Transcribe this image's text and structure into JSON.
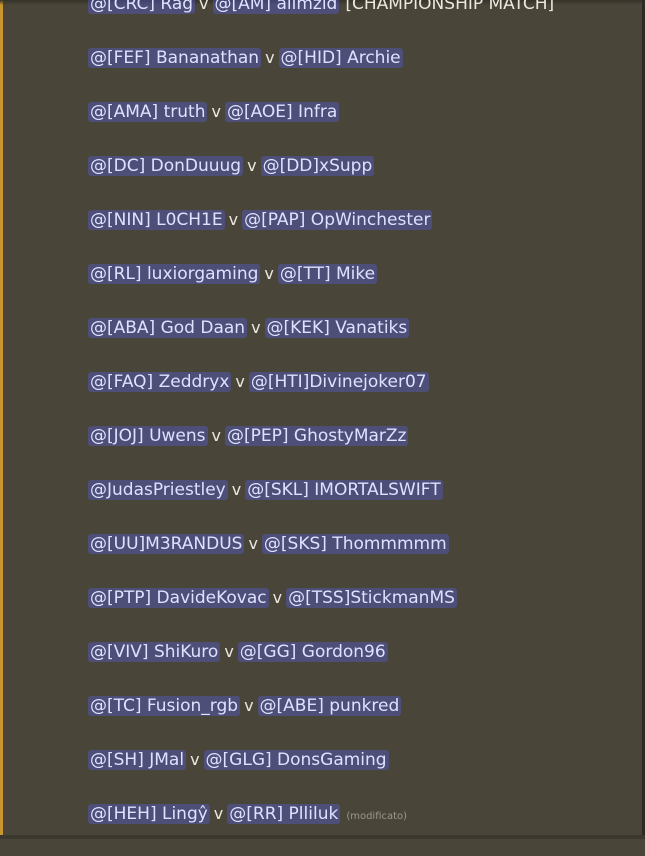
{
  "matches": [
    {
      "p1": "@[CRC] Rag",
      "vs": "v",
      "p2": "@[AM] alimzid",
      "tag": "[CHAMPIONSHIP MATCH]"
    },
    {
      "p1": "@[FEF] Bananathan",
      "vs": "v",
      "p2": "@[HID] Archie"
    },
    {
      "p1": "@[AMA] truth",
      "vs": "v",
      "p2": "@[AOE] Infra"
    },
    {
      "p1": "@[DC] DonDuuug",
      "vs": "v",
      "p2": "@[DD]xSupp"
    },
    {
      "p1": "@[NIN] L0CH1E",
      "vs": "v",
      "p2": "@[PAP] OpWinchester"
    },
    {
      "p1": "@[RL] luxiorgaming",
      "vs": "v",
      "p2": "@[TT] Mike"
    },
    {
      "p1": "@[ABA] God Daan",
      "vs": "v",
      "p2": "@[KEK] Vanatiks"
    },
    {
      "p1": "@[FAQ] Zeddryx",
      "vs": "v",
      "p2": "@[HTI]Divinejoker07"
    },
    {
      "p1": "@[JOJ] Uwens",
      "vs": "v",
      "p2": "@[PEP] GhostyMarZz"
    },
    {
      "p1": "@JudasPriestley",
      "vs": "v",
      "p2": "@[SKL] IMORTALSWIFT"
    },
    {
      "p1": "@[UU]M3RANDUS",
      "vs": "v",
      "p2": "@[SKS] Thommmmm"
    },
    {
      "p1": "@[PTP] DavideKovac",
      "vs": "v",
      "p2": "@[TSS]StickmanMS"
    },
    {
      "p1": "@[VIV] ShiKuro",
      "vs": "v",
      "p2": "@[GG] Gordon96"
    },
    {
      "p1": "@[TC] Fusion_rgb",
      "vs": "v",
      "p2": "@[ABE] punkred"
    },
    {
      "p1": "@[SH] JMal",
      "vs": "v",
      "p2": "@[GLG] DonsGaming"
    },
    {
      "p1": "@[HEH] Lingŷ",
      "vs": "v",
      "p2": "@[RR] Plliluk",
      "edited": "(modificato)"
    }
  ],
  "colors": {
    "background": "#494539",
    "accent_bar": "#c7962e",
    "mention_bg": "rgba(88,101,242,0.34)",
    "mention_text": "#dde2ff"
  }
}
